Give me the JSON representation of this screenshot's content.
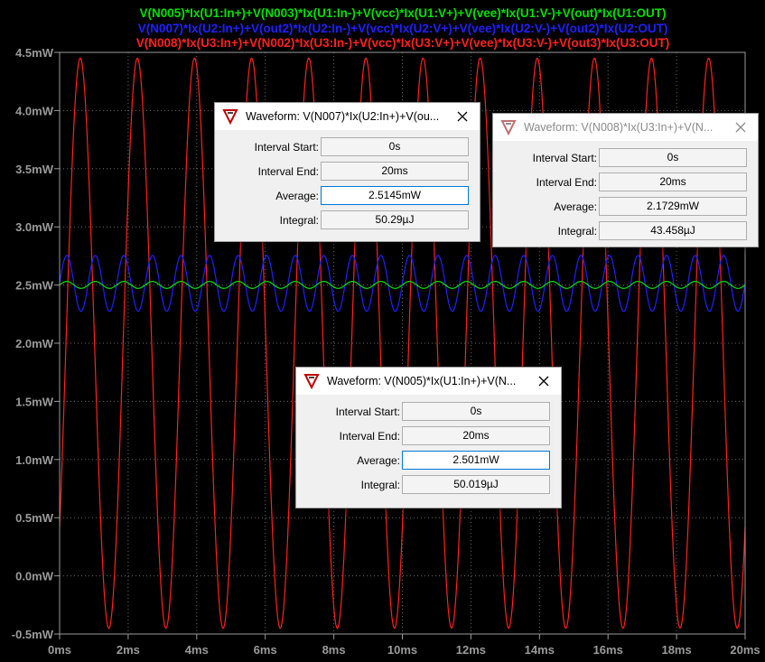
{
  "plot": {
    "legend": [
      {
        "text": "V(N005)*Ix(U1:In+)+V(N003)*Ix(U1:In-)+V(vcc)*Ix(U1:V+)+V(vee)*Ix(U1:V-)+V(out)*Ix(U1:OUT)",
        "color": "#00e000"
      },
      {
        "text": "V(N007)*Ix(U2:In+)+V(out2)*Ix(U2:In-)+V(vcc)*Ix(U2:V+)+V(vee)*Ix(U2:V-)+V(out2)*Ix(U2:OUT)",
        "color": "#2020ff"
      },
      {
        "text": "V(N008)*Ix(U3:In+)+V(N002)*Ix(U3:In-)+V(vcc)*Ix(U3:V+)+V(vee)*Ix(U3:V-)+V(out3)*Ix(U3:OUT)",
        "color": "#ff2020"
      }
    ],
    "y_ticks": [
      "-0.5mW",
      "0.0mW",
      "0.5mW",
      "1.0mW",
      "1.5mW",
      "2.0mW",
      "2.5mW",
      "3.0mW",
      "3.5mW",
      "4.0mW",
      "4.5mW"
    ],
    "x_ticks": [
      "0ms",
      "2ms",
      "4ms",
      "6ms",
      "8ms",
      "10ms",
      "12ms",
      "14ms",
      "16ms",
      "18ms",
      "20ms"
    ]
  },
  "chart_data": {
    "type": "line",
    "xlim": [
      0,
      20
    ],
    "ylim": [
      -0.5,
      4.5
    ],
    "series": [
      {
        "name": "V(N005)*Ix(U1:In+)+V(N003)*Ix(U1:In-)+V(vcc)*Ix(U1:V+)+V(vee)*Ix(U1:V-)+V(out)*Ix(U1:OUT)",
        "color": "#00e000",
        "average": 2.501,
        "amplitude": 0.03,
        "period_ms": 0.8333,
        "phase": 0
      },
      {
        "name": "V(N007)*Ix(U2:In+)+V(out2)*Ix(U2:In-)+V(vcc)*Ix(U2:V+)+V(vee)*Ix(U2:V-)+V(out2)*Ix(U2:OUT)",
        "color": "#2020ff",
        "average": 2.5145,
        "amplitude": 0.24,
        "period_ms": 0.8333,
        "phase": 0
      },
      {
        "name": "V(N008)*Ix(U3:In+)+V(N002)*Ix(U3:In-)+V(vcc)*Ix(U3:V+)+V(vee)*Ix(U3:V-)+V(out3)*Ix(U3:OUT)",
        "color": "#ff2020",
        "average": 2.0,
        "amplitude": 2.45,
        "period_ms": 1.6667,
        "phase": -0.7
      }
    ]
  },
  "dialogs": [
    {
      "title": "Waveform: V(N007)*Ix(U2:In+)+V(ou...",
      "active": true,
      "interval_start_label": "Interval Start:",
      "interval_start": "0s",
      "interval_end_label": "Interval End:",
      "interval_end": "20ms",
      "average_label": "Average:",
      "average": "2.5145mW",
      "integral_label": "Integral:",
      "integral": "50.29µJ"
    },
    {
      "title": "Waveform: V(N008)*Ix(U3:In+)+V(N...",
      "active": false,
      "interval_start_label": "Interval Start:",
      "interval_start": "0s",
      "interval_end_label": "Interval End:",
      "interval_end": "20ms",
      "average_label": "Average:",
      "average": "2.1729mW",
      "integral_label": "Integral:",
      "integral": "43.458µJ"
    },
    {
      "title": "Waveform: V(N005)*Ix(U1:In+)+V(N...",
      "active": true,
      "interval_start_label": "Interval Start:",
      "interval_start": "0s",
      "interval_end_label": "Interval End:",
      "interval_end": "20ms",
      "average_label": "Average:",
      "average": "2.501mW",
      "integral_label": "Integral:",
      "integral": "50.019µJ"
    }
  ]
}
